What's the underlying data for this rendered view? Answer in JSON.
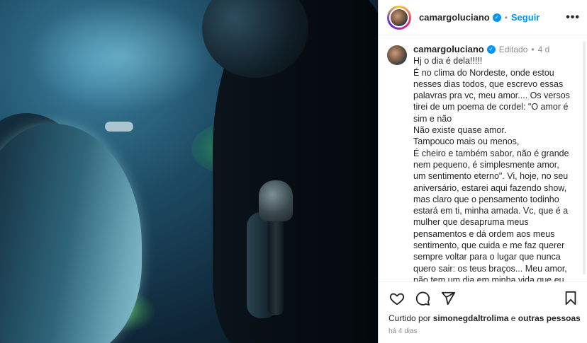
{
  "photo": {
    "description_icon": "concert-photo"
  },
  "post": {
    "username": "camargoluciano",
    "separator": "•",
    "follow_label": "Seguir",
    "more_label": "•••",
    "edited_label": "Editado",
    "time_ago": "4 d",
    "caption_lines": [
      "Hj o dia é dela!!!!!",
      "É no clima do Nordeste, onde estou",
      "nesses dias todos, que escrevo essas",
      "palavras pra vc, meu  amor.... Os versos",
      "tirei de um poema de cordel: \"O amor é",
      "sim e não",
      "Não existe quase amor.",
      "Tampouco mais ou menos,",
      "É cheiro e também sabor, não é grande",
      "nem pequeno, é simplesmente amor,",
      "um sentimento eterno\". Vi, hoje, no seu",
      "aniversário, estarei aqui fazendo show,",
      "mas claro que o pensamento todinho",
      "estará em ti, minha amada. Vc, que é a",
      "mulher que desapruma meus",
      "pensamentos e dá ordem aos meus",
      "sentimento, que cuida e me faz  querer",
      "sempre voltar para o lugar que nunca",
      "quero sair: os teus braços... Meu amor,",
      "não tem um dia em minha vida que eu"
    ],
    "likes_prefix": "Curtido por",
    "liked_by_user": "simonegdaltrolima",
    "likes_conjunction": "e",
    "likes_others": "outras pessoas",
    "date": "há 4 dias"
  },
  "colors": {
    "accent": "#0095f6",
    "muted": "#8e8e8e",
    "text": "#262626"
  }
}
